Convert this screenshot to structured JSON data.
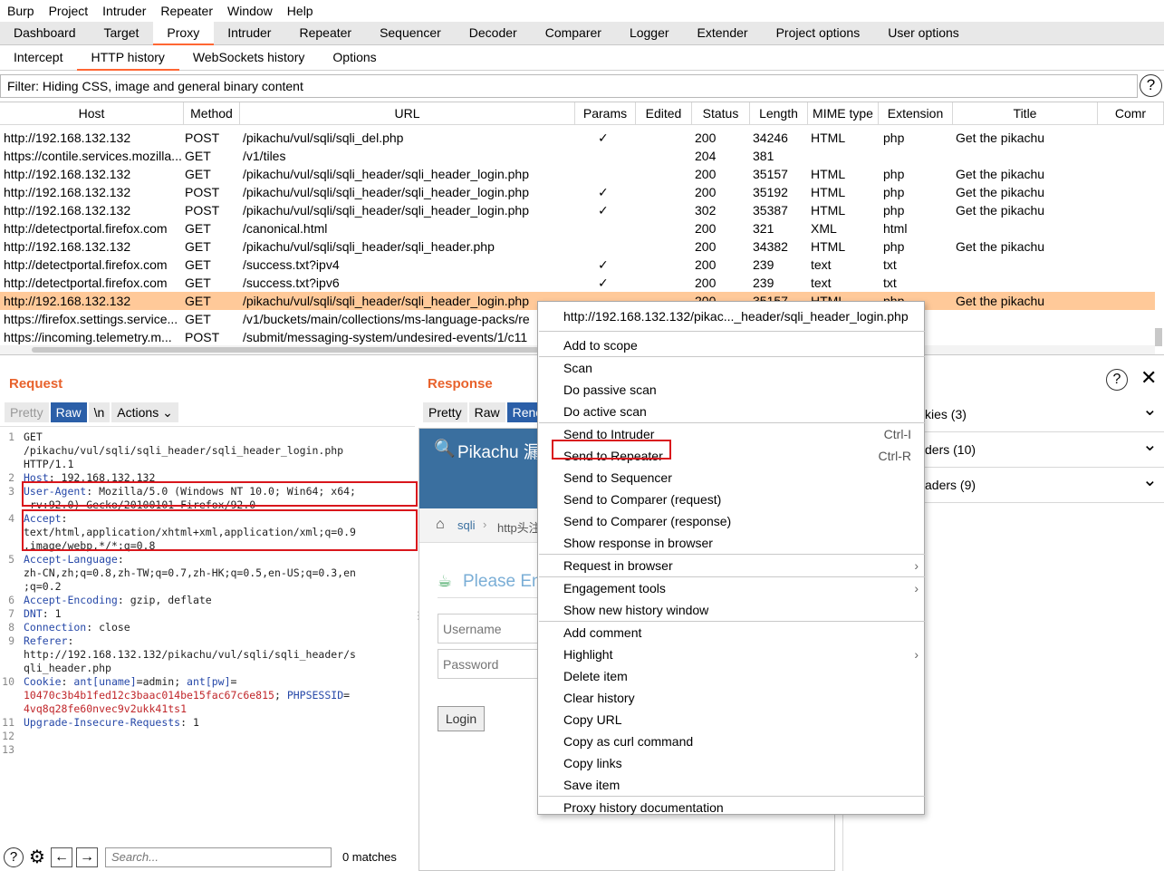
{
  "menubar": [
    "Burp",
    "Project",
    "Intruder",
    "Repeater",
    "Window",
    "Help"
  ],
  "main_tabs": [
    "Dashboard",
    "Target",
    "Proxy",
    "Intruder",
    "Repeater",
    "Sequencer",
    "Decoder",
    "Comparer",
    "Logger",
    "Extender",
    "Project options",
    "User options"
  ],
  "sub_tabs": [
    "Intercept",
    "HTTP history",
    "WebSockets history",
    "Options"
  ],
  "filter": "Filter: Hiding CSS, image and general binary content",
  "table": {
    "headers": [
      "Host",
      "Method",
      "URL",
      "Params",
      "Edited",
      "Status",
      "Length",
      "MIME type",
      "Extension",
      "Title",
      "Comr"
    ],
    "rows": [
      {
        "host": "http://192.168.132.132",
        "method": "POST",
        "url": "/pikachu/vul/sqli/sqli_del.php",
        "params": "✓",
        "status": "200",
        "length": "34246",
        "mime": "HTML",
        "ext": "php",
        "title": "Get the pikachu"
      },
      {
        "host": "https://contile.services.mozilla...",
        "method": "GET",
        "url": "/v1/tiles",
        "params": "",
        "status": "204",
        "length": "381",
        "mime": "",
        "ext": "",
        "title": ""
      },
      {
        "host": "http://192.168.132.132",
        "method": "GET",
        "url": "/pikachu/vul/sqli/sqli_header/sqli_header_login.php",
        "params": "",
        "status": "200",
        "length": "35157",
        "mime": "HTML",
        "ext": "php",
        "title": "Get the pikachu"
      },
      {
        "host": "http://192.168.132.132",
        "method": "POST",
        "url": "/pikachu/vul/sqli/sqli_header/sqli_header_login.php",
        "params": "✓",
        "status": "200",
        "length": "35192",
        "mime": "HTML",
        "ext": "php",
        "title": "Get the pikachu"
      },
      {
        "host": "http://192.168.132.132",
        "method": "POST",
        "url": "/pikachu/vul/sqli/sqli_header/sqli_header_login.php",
        "params": "✓",
        "status": "302",
        "length": "35387",
        "mime": "HTML",
        "ext": "php",
        "title": "Get the pikachu"
      },
      {
        "host": "http://detectportal.firefox.com",
        "method": "GET",
        "url": "/canonical.html",
        "params": "",
        "status": "200",
        "length": "321",
        "mime": "XML",
        "ext": "html",
        "title": ""
      },
      {
        "host": "http://192.168.132.132",
        "method": "GET",
        "url": "/pikachu/vul/sqli/sqli_header/sqli_header.php",
        "params": "",
        "status": "200",
        "length": "34382",
        "mime": "HTML",
        "ext": "php",
        "title": "Get the pikachu"
      },
      {
        "host": "http://detectportal.firefox.com",
        "method": "GET",
        "url": "/success.txt?ipv4",
        "params": "✓",
        "status": "200",
        "length": "239",
        "mime": "text",
        "ext": "txt",
        "title": ""
      },
      {
        "host": "http://detectportal.firefox.com",
        "method": "GET",
        "url": "/success.txt?ipv6",
        "params": "✓",
        "status": "200",
        "length": "239",
        "mime": "text",
        "ext": "txt",
        "title": ""
      },
      {
        "host": "http://192.168.132.132",
        "method": "GET",
        "url": "/pikachu/vul/sqli/sqli_header/sqli_header_login.php",
        "params": "",
        "status": "200",
        "length": "35157",
        "mime": "HTML",
        "ext": "php",
        "title": "Get the pikachu"
      },
      {
        "host": "https://firefox.settings.service...",
        "method": "GET",
        "url": "/v1/buckets/main/collections/ms-language-packs/re",
        "params": "",
        "status": "",
        "length": "",
        "mime": "",
        "ext": "",
        "title": ""
      },
      {
        "host": "https://incoming.telemetry.m...",
        "method": "POST",
        "url": "/submit/messaging-system/undesired-events/1/c11",
        "params": "",
        "status": "",
        "length": "",
        "mime": "",
        "ext": "",
        "title": ""
      }
    ]
  },
  "request": {
    "title": "Request",
    "buttons": [
      "Pretty",
      "Raw",
      "\\n",
      "Actions ⌄"
    ],
    "lines": [
      {
        "n": "1",
        "parts": [
          {
            "t": "GET\n/pikachu/vul/sqli/sqli_header/sqli_header_login.php\nHTTP/1.1",
            "c": ""
          }
        ]
      },
      {
        "n": "2",
        "parts": [
          {
            "t": "Host",
            "c": "k"
          },
          {
            "t": ": 192.168.132.132",
            "c": ""
          }
        ]
      },
      {
        "n": "3",
        "parts": [
          {
            "t": "User-Agent",
            "c": "k"
          },
          {
            "t": ": Mozilla/5.0 (Windows NT 10.0; Win64; x64;\n rv:92.0) Gecko/20100101 Firefox/92.0",
            "c": ""
          }
        ]
      },
      {
        "n": "4",
        "parts": [
          {
            "t": "Accept",
            "c": "k"
          },
          {
            "t": ":\ntext/html,application/xhtml+xml,application/xml;q=0.9\n,image/webp,*/*;q=0.8",
            "c": ""
          }
        ]
      },
      {
        "n": "5",
        "parts": [
          {
            "t": "Accept-Language",
            "c": "k"
          },
          {
            "t": ":\nzh-CN,zh;q=0.8,zh-TW;q=0.7,zh-HK;q=0.5,en-US;q=0.3,en\n;q=0.2",
            "c": ""
          }
        ]
      },
      {
        "n": "6",
        "parts": [
          {
            "t": "Accept-Encoding",
            "c": "k"
          },
          {
            "t": ": gzip, deflate",
            "c": ""
          }
        ]
      },
      {
        "n": "7",
        "parts": [
          {
            "t": "DNT",
            "c": "k"
          },
          {
            "t": ": 1",
            "c": ""
          }
        ]
      },
      {
        "n": "8",
        "parts": [
          {
            "t": "Connection",
            "c": "k"
          },
          {
            "t": ": close",
            "c": ""
          }
        ]
      },
      {
        "n": "9",
        "parts": [
          {
            "t": "Referer",
            "c": "k"
          },
          {
            "t": ":\nhttp://192.168.132.132/pikachu/vul/sqli/sqli_header/s\nqli_header.php",
            "c": ""
          }
        ]
      },
      {
        "n": "10",
        "parts": [
          {
            "t": "Cookie",
            "c": "k"
          },
          {
            "t": ": ",
            "c": ""
          },
          {
            "t": "ant[uname]",
            "c": "k"
          },
          {
            "t": "=admin; ",
            "c": ""
          },
          {
            "t": "ant[pw]",
            "c": "k"
          },
          {
            "t": "=\n",
            "c": ""
          },
          {
            "t": "10470c3b4b1fed12c3baac014be15fac67c6e815",
            "c": "r"
          },
          {
            "t": "; ",
            "c": ""
          },
          {
            "t": "PHPSESSID",
            "c": "k"
          },
          {
            "t": "=\n",
            "c": ""
          },
          {
            "t": "4vq8q28fe60nvec9v2ukk41ts1",
            "c": "r"
          }
        ]
      },
      {
        "n": "11",
        "parts": [
          {
            "t": "Upgrade-Insecure-Requests",
            "c": "k"
          },
          {
            "t": ": 1",
            "c": ""
          }
        ]
      },
      {
        "n": "12",
        "parts": []
      },
      {
        "n": "13",
        "parts": []
      }
    ],
    "search_placeholder": "Search...",
    "matches": "0 matches"
  },
  "response": {
    "title": "Response",
    "buttons": [
      "Pretty",
      "Raw",
      "Renc"
    ],
    "render": {
      "brand": "Pikachu 漏",
      "breadcrumb_home": "sqli",
      "breadcrumb_next": "http头注",
      "heading": "Please Ent",
      "username_ph": "Username",
      "password_ph": "Password",
      "login": "Login"
    }
  },
  "inspector": {
    "rows": [
      "kies (3)",
      "ders (10)",
      "aders (9)"
    ]
  },
  "context_menu": {
    "header": "http://192.168.132.132/pikac..._header/sqli_header_login.php",
    "items": [
      {
        "label": "Add to scope"
      },
      {
        "label": "Scan"
      },
      {
        "label": "Do passive scan"
      },
      {
        "label": "Do active scan"
      },
      {
        "label": "Send to Intruder",
        "shortcut": "Ctrl-I"
      },
      {
        "label": "Send to Repeater",
        "shortcut": "Ctrl-R"
      },
      {
        "label": "Send to Sequencer"
      },
      {
        "label": "Send to Comparer (request)"
      },
      {
        "label": "Send to Comparer (response)"
      },
      {
        "label": "Show response in browser"
      },
      {
        "label": "Request in browser",
        "arrow": "›"
      },
      {
        "label": "Engagement tools",
        "arrow": "›"
      },
      {
        "label": "Show new history window"
      },
      {
        "label": "Add comment"
      },
      {
        "label": "Highlight",
        "arrow": "›"
      },
      {
        "label": "Delete item"
      },
      {
        "label": "Clear history"
      },
      {
        "label": "Copy URL"
      },
      {
        "label": "Copy as curl command"
      },
      {
        "label": "Copy links"
      },
      {
        "label": "Save item"
      },
      {
        "label": "Proxy history documentation"
      }
    ]
  },
  "colors": {
    "accent": "#ff6633",
    "selected_row": "#ffc999",
    "highlight_box": "#d9161c",
    "raw_button": "#2b5fa8",
    "pikachu_header": "#3a6f9f"
  }
}
